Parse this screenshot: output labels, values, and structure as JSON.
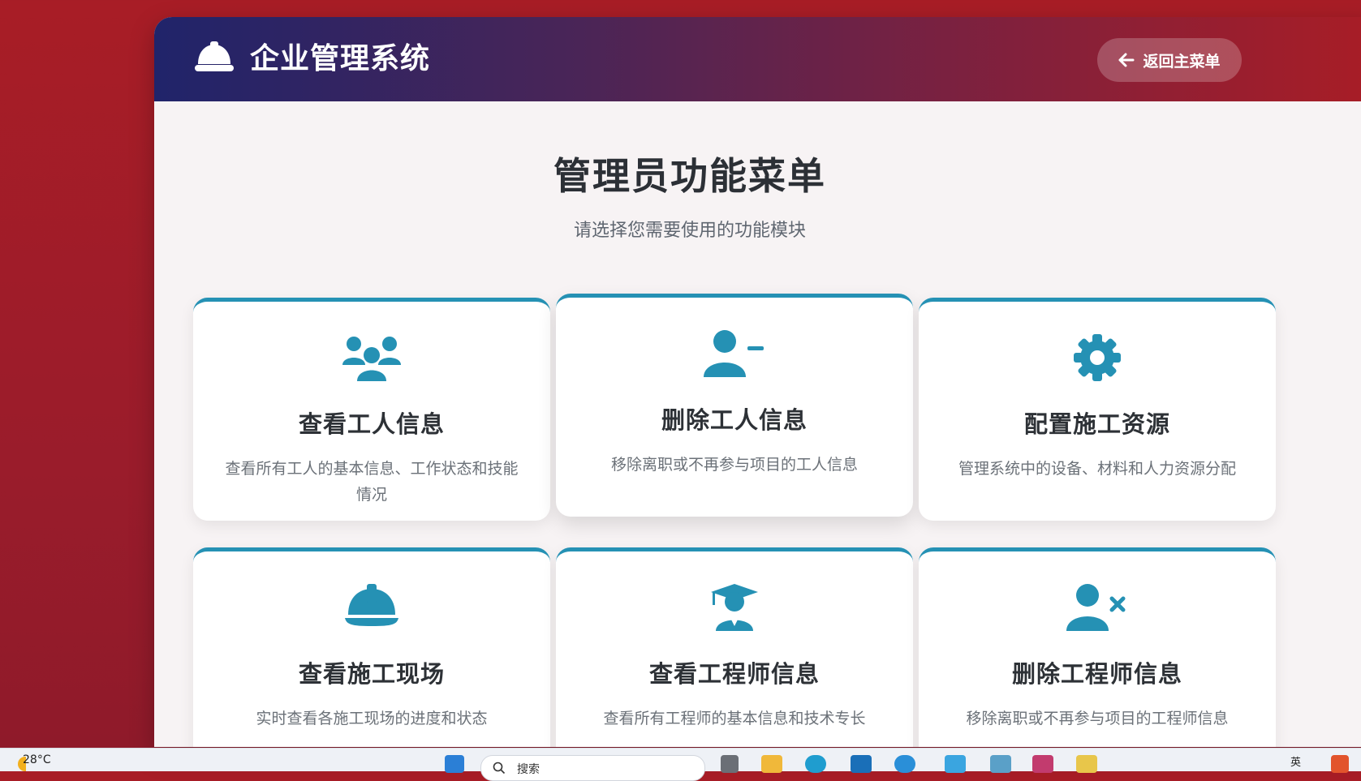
{
  "header": {
    "title": "企业管理系统",
    "back_label": "返回主菜单"
  },
  "main": {
    "title": "管理员功能菜单",
    "subtitle": "请选择您需要使用的功能模块",
    "cards": [
      {
        "icon": "users-icon",
        "title": "查看工人信息",
        "desc": "查看所有工人的基本信息、工作状态和技能情况"
      },
      {
        "icon": "user-minus-icon",
        "title": "删除工人信息",
        "desc": "移除离职或不再参与项目的工人信息"
      },
      {
        "icon": "gear-icon",
        "title": "配置施工资源",
        "desc": "管理系统中的设备、材料和人力资源分配"
      },
      {
        "icon": "hard-hat-icon",
        "title": "查看施工现场",
        "desc": "实时查看各施工现场的进度和状态"
      },
      {
        "icon": "graduate-icon",
        "title": "查看工程师信息",
        "desc": "查看所有工程师的基本信息和技术专长"
      },
      {
        "icon": "user-x-icon",
        "title": "删除工程师信息",
        "desc": "移除离职或不再参与项目的工程师信息"
      }
    ]
  },
  "taskbar": {
    "weather": "28°C",
    "search_placeholder": "搜索",
    "lang": "英"
  },
  "colors": {
    "accent": "#2591b4",
    "background": "#a81d26",
    "header_start": "#20246a",
    "header_end": "#a81d26"
  }
}
